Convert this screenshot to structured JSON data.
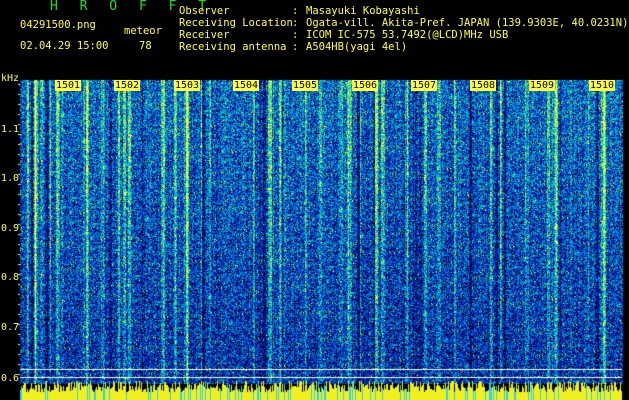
{
  "header": {
    "app_title": "H R O F F T",
    "filename": "04291500.png",
    "detection_type": "meteor",
    "datetime": "02.04.29 15:00",
    "detection_count": "78"
  },
  "metadata": [
    {
      "label": "Observer",
      "colon": ":",
      "value": "Masayuki Kobayashi"
    },
    {
      "label": "Receiving Location",
      "colon": ":",
      "value": "Ogata-vill. Akita-Pref. JAPAN (139.9303E, 40.0231N)"
    },
    {
      "label": "Receiver",
      "colon": ":",
      "value": "ICOM IC-575 53.7492(@LCD)MHz USB"
    },
    {
      "label": "Receiving antenna",
      "colon": ":",
      "value": "A504HB(yagi 4el)"
    }
  ],
  "spectrogram": {
    "y_unit": "kHz",
    "y_ticks": [
      "1.1",
      "1.0",
      "0.9",
      "0.8",
      "0.7",
      "0.6"
    ],
    "time_labels": [
      "1501",
      "1502",
      "1503",
      "1504",
      "1505",
      "1506",
      "1507",
      "1508",
      "1509",
      "1510"
    ]
  },
  "colors": {
    "text_yellow": "#ffff40",
    "title_green": "#20e020",
    "background": "#000000",
    "marker_line": "#ffffff"
  }
}
